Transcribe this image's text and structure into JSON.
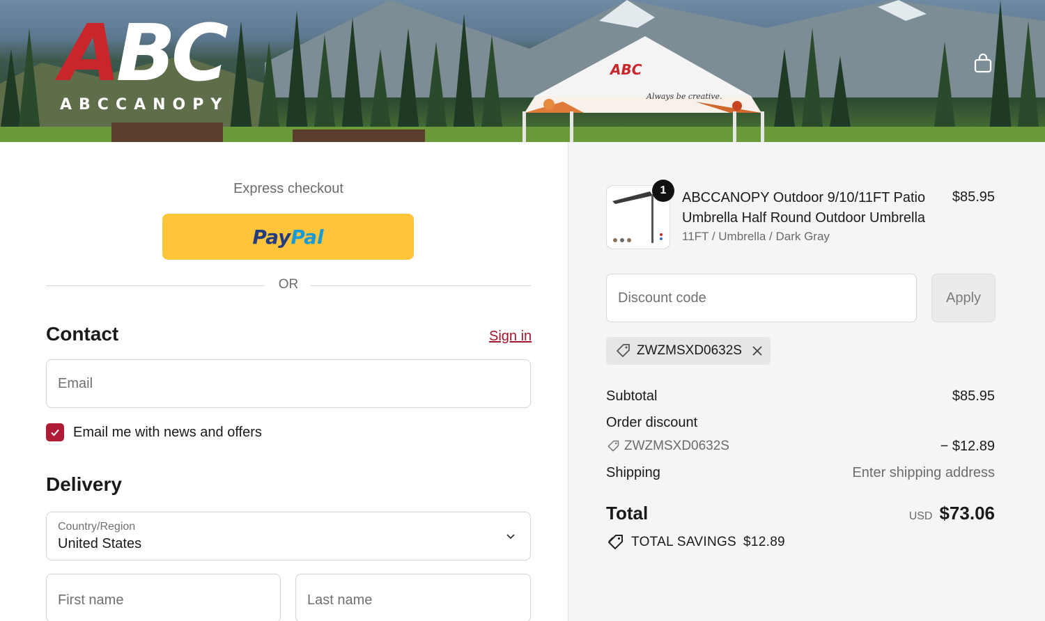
{
  "brand": {
    "logo_mark_a": "A",
    "logo_mark_bc": "BC",
    "logo_sub": "ABCCANOPY",
    "tent_brand": "ABC",
    "tent_slogan": "Always be creative.",
    "accent": "#c8262b"
  },
  "header": {
    "cart_icon": "shopping-bag-icon"
  },
  "express": {
    "label": "Express checkout",
    "paypal_part1": "Pay",
    "paypal_part2": "Pal",
    "or_label": "OR"
  },
  "contact": {
    "title": "Contact",
    "signin_label": "Sign in",
    "email_placeholder": "Email",
    "newsletter_label": "Email me with news and offers",
    "newsletter_checked": true
  },
  "delivery": {
    "title": "Delivery",
    "country_label": "Country/Region",
    "country_value": "United States",
    "first_name_placeholder": "First name",
    "last_name_placeholder": "Last name"
  },
  "summary": {
    "item": {
      "quantity": "1",
      "title": "ABCCANOPY Outdoor 9/10/11FT Patio Umbrella Half Round Outdoor Umbrella",
      "variant": "11FT / Umbrella / Dark Gray",
      "price": "$85.95"
    },
    "discount_placeholder": "Discount code",
    "apply_label": "Apply",
    "applied_code": "ZWZMSXD0632S",
    "subtotal_label": "Subtotal",
    "subtotal_value": "$85.95",
    "order_discount_label": "Order discount",
    "order_discount_code": "ZWZMSXD0632S",
    "order_discount_value": "− $12.89",
    "shipping_label": "Shipping",
    "shipping_value": "Enter shipping address",
    "total_label": "Total",
    "total_currency": "USD",
    "total_value": "$73.06",
    "savings_label": "TOTAL SAVINGS",
    "savings_value": "$12.89"
  }
}
